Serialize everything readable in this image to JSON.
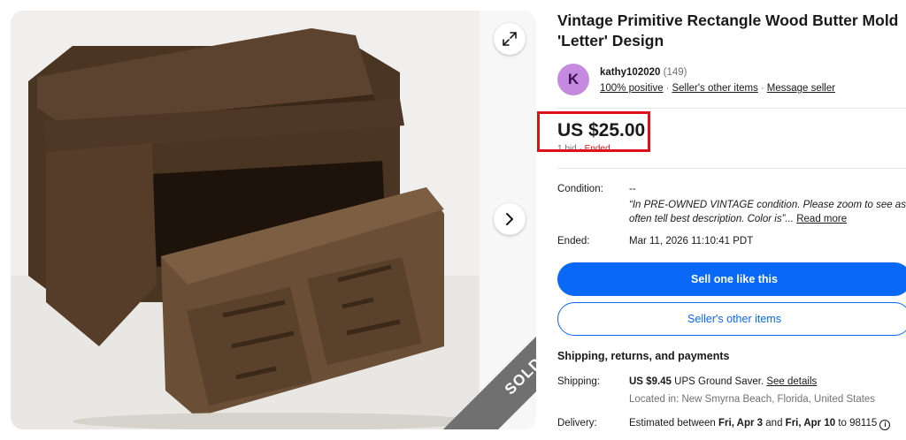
{
  "listing": {
    "title": "Vintage Primitive Rectangle Wood Butter Mold 'Letter' Design",
    "status_ribbon": "SOLD"
  },
  "seller": {
    "avatar_letter": "K",
    "name": "kathy102020",
    "feedback_count": "(149)",
    "positive": "100% positive",
    "separator": "·",
    "other_items_link": "Seller's other items",
    "message_link": "Message seller"
  },
  "price": {
    "amount": "US $25.00",
    "bids": "1 bid",
    "separator": "·",
    "ended": "Ended"
  },
  "condition": {
    "label": "Condition:",
    "value": "--",
    "description_line1": "“In PRE-OWNED VINTAGE condition. Please zoom to see as ph",
    "description_line2": "often tell best description. Color is”",
    "ellipsis": "...",
    "read_more": "Read more"
  },
  "ended": {
    "label": "Ended:",
    "value": "Mar 11, 2026 11:10:41 PDT"
  },
  "buttons": {
    "sell_one": "Sell one like this",
    "sellers_other": "Seller's other items"
  },
  "shipping": {
    "section_title": "Shipping, returns, and payments",
    "label": "Shipping:",
    "cost": "US $9.45",
    "service": "UPS Ground Saver.",
    "see_details": "See details",
    "location": "Located in: New Smyrna Beach, Florida, United States"
  },
  "delivery": {
    "label": "Delivery:",
    "prefix": "Estimated between",
    "date_start": "Fri, Apr 3",
    "and": "and",
    "date_end": "Fri, Apr 10",
    "to": "to 98115",
    "info_icon": "i"
  },
  "icons": {
    "expand": "expand-icon",
    "next": "chevron-right-icon",
    "info": "info-icon"
  },
  "colors": {
    "primary": "#0968f6",
    "highlight_box": "#e0101a",
    "sold_ribbon": "#707070",
    "avatar": "#c58ae0"
  }
}
